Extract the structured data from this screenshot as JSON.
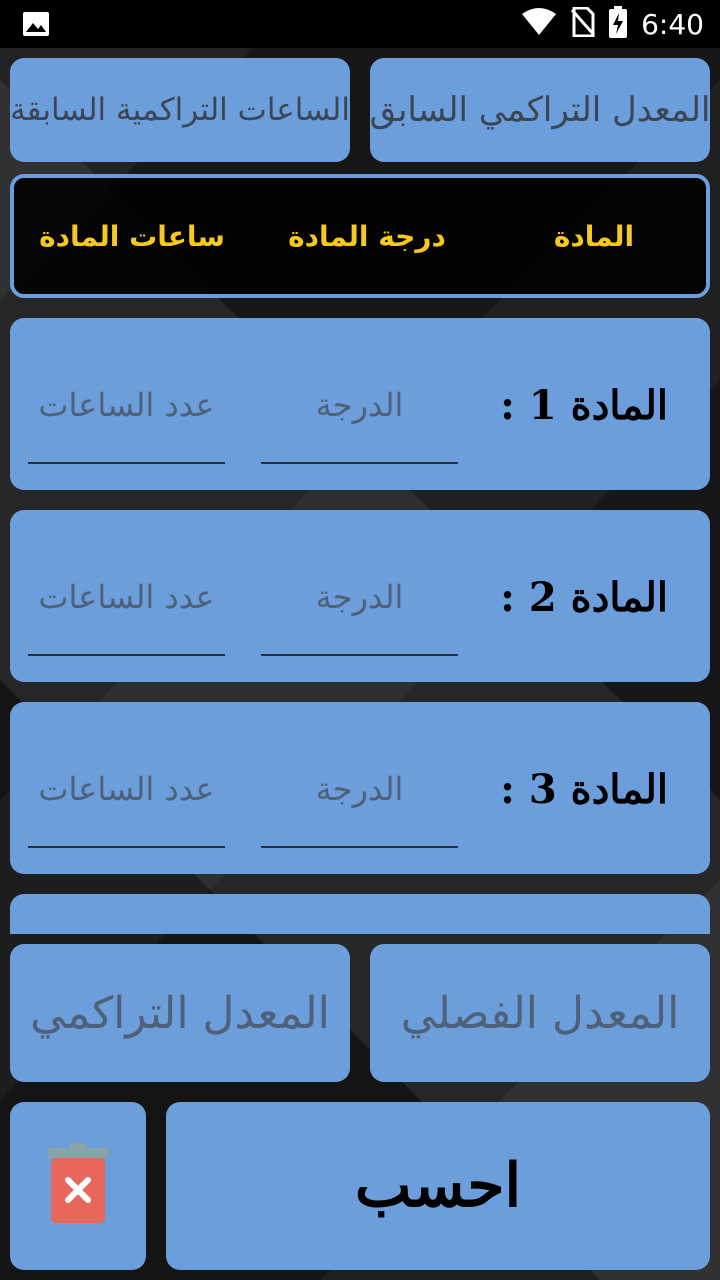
{
  "status_bar": {
    "time": "6:40",
    "icons": [
      "image-icon",
      "wifi-icon",
      "no-sim-icon",
      "battery-charging-icon"
    ]
  },
  "top_buttons": {
    "previous_gpa": "المعدل التراكمي السابق",
    "previous_hours": "الساعات التراكمية السابقة"
  },
  "header": {
    "subject": "المادة",
    "subject_grade": "درجة المادة",
    "subject_hours": "ساعات المادة"
  },
  "subjects": [
    {
      "label": "المادة 1 :",
      "grade_placeholder": "الدرجة",
      "hours_placeholder": "عدد الساعات"
    },
    {
      "label": "المادة 2 :",
      "grade_placeholder": "الدرجة",
      "hours_placeholder": "عدد الساعات"
    },
    {
      "label": "المادة 3 :",
      "grade_placeholder": "الدرجة",
      "hours_placeholder": "عدد الساعات"
    }
  ],
  "results": {
    "semester_gpa": "المعدل الفصلي",
    "cumulative_gpa": "المعدل التراكمي"
  },
  "actions": {
    "calculate": "احسب"
  },
  "colors": {
    "card": "#6b9edb",
    "header_text": "#f7c81e",
    "trash_body": "#e8675a",
    "trash_lid": "#8aa3a8"
  }
}
